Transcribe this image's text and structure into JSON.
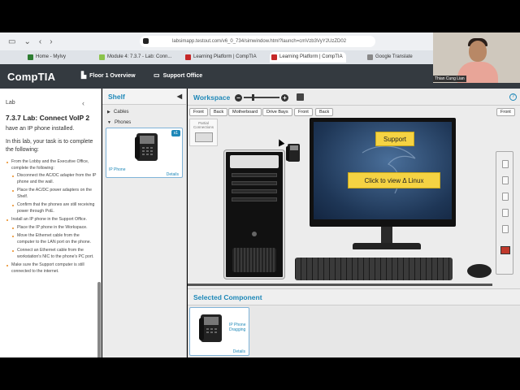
{
  "browser": {
    "url": "labsimapp.testout.com/v6_0_734/simwindow.html?launch=cmVzb3VyY2UzZD02",
    "tabs": [
      {
        "label": "Home - MyIvy",
        "color": "#2e7d32"
      },
      {
        "label": "Module 4: 7.3.7 - Lab: Conn...",
        "color": "#8bc34a"
      },
      {
        "label": "Learning Platform | CompTIA",
        "color": "#c62828"
      },
      {
        "label": "Learning Platform | CompTIA",
        "color": "#c62828"
      },
      {
        "label": "Google Translate",
        "color": "#888888"
      }
    ]
  },
  "webcam": {
    "name": "Thian Cung Lian"
  },
  "header": {
    "logo": "CompTIA",
    "nav": [
      {
        "label": "Floor 1 Overview",
        "icon": "building-icon"
      },
      {
        "label": "Support Office",
        "icon": "monitor-icon"
      }
    ]
  },
  "sidebar": {
    "tab": "Lab",
    "title": "7.3.7 Lab: Connect VoIP 2",
    "intro_cut": "have an IP phone installed.",
    "task": "In this lab, your task is to complete the following:",
    "steps": [
      {
        "text": "From the Lobby and the Executive Office, complete the following:",
        "sub": [
          "Disconnect the AC/DC adapter from the IP phone and the wall.",
          "Place the AC/DC power adapters on the Shelf.",
          "Confirm that the phones are still receiving power through PoE."
        ]
      },
      {
        "text": "Install an IP phone in the Support Office.",
        "sub": [
          "Place the IP phone in the Workspace.",
          "Move the Ethernet cable from the computer to the LAN port on the phone.",
          "Connect an Ethernet cable from the workstation's NIC to the phone's PC port."
        ]
      },
      {
        "text": "Make sure the Support computer is still connected to the internet.",
        "sub": []
      }
    ]
  },
  "shelf": {
    "title": "Shelf",
    "categories": [
      "Cables",
      "Phones"
    ],
    "item": {
      "caption": "IP Phone",
      "count": "x1",
      "details": "Details"
    }
  },
  "workspace": {
    "title": "Workspace",
    "left_buttons": [
      "Front",
      "Back",
      "Motherboard",
      "Drive Bays"
    ],
    "right_buttons": [
      "Front",
      "Back"
    ],
    "far_button": "Front",
    "partial": "Partial Connections",
    "screen": {
      "support": "Support",
      "view": "Click to view Δ Linux"
    }
  },
  "selected": {
    "title": "Selected Component",
    "caption": "IP Phone Dragging",
    "details": "Details"
  }
}
